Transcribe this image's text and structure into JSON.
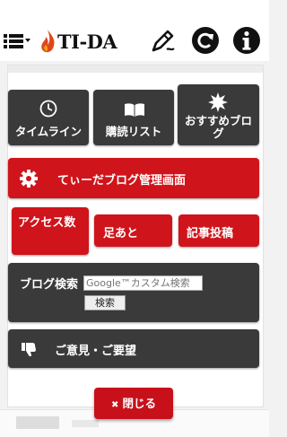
{
  "header": {
    "logo_text": "TI-DA",
    "menu_icon": "list-menu-icon",
    "edit_icon": "pen-edit-icon",
    "refresh_icon": "refresh-icon",
    "info_icon": "info-icon"
  },
  "menu": {
    "timeline": "タイムライン",
    "reading_list": "購読リスト",
    "recommended": "おすすめブログ",
    "admin": "てぃーだブログ管理画面",
    "access_count": "アクセス数",
    "footprints": "足あと",
    "post_article": "記事投稿",
    "blog_search": "ブログ検索",
    "search_placeholder": "Google™カスタム検索",
    "search_button": "検索",
    "feedback": "ご意見・ご要望",
    "close": "閉じる"
  },
  "colors": {
    "red": "#d0141b",
    "dark": "#3a3a3a"
  }
}
